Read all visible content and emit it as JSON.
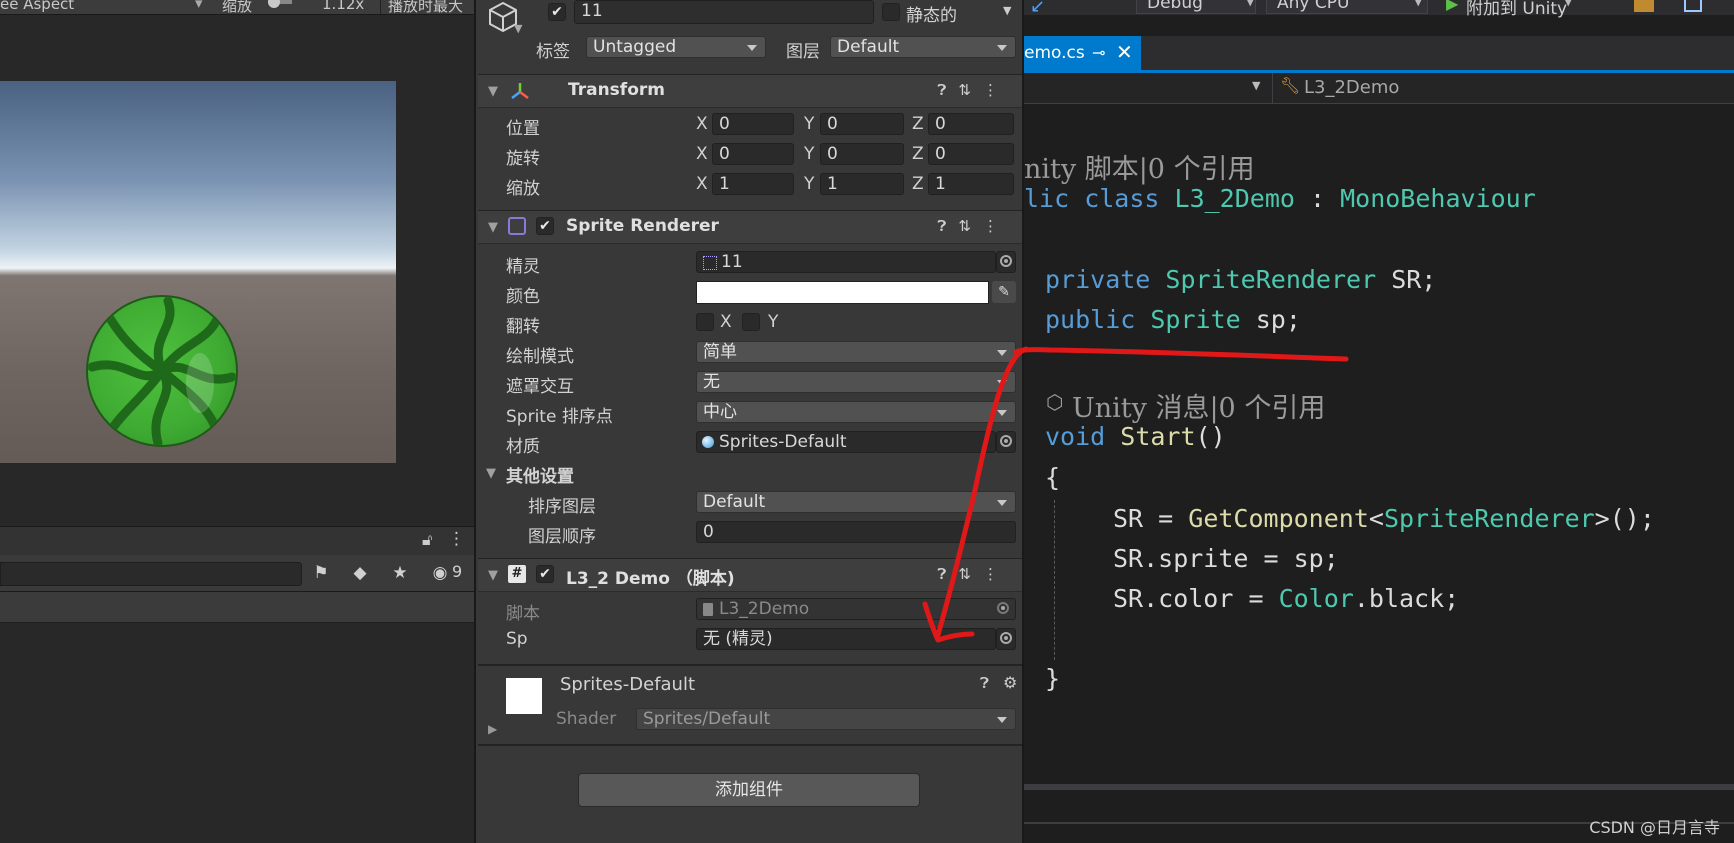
{
  "game_toolbar": {
    "aspect": "ee Aspect",
    "scale_label": "缩放",
    "scale_value": "1.12x",
    "maximize": "播放时最大"
  },
  "hierarchy": {
    "count": "9"
  },
  "inspector": {
    "object_name": "11",
    "static_label": "静态的",
    "tag_label": "标签",
    "tag_value": "Untagged",
    "layer_label": "图层",
    "layer_value": "Default",
    "transform": {
      "title": "Transform",
      "rows": [
        {
          "label": "位置",
          "x": "0",
          "y": "0",
          "z": "0"
        },
        {
          "label": "旋转",
          "x": "0",
          "y": "0",
          "z": "0"
        },
        {
          "label": "缩放",
          "x": "1",
          "y": "1",
          "z": "1"
        }
      ],
      "axis_x": "X",
      "axis_y": "Y",
      "axis_z": "Z"
    },
    "sprite_renderer": {
      "title": "Sprite Renderer",
      "sprite_label": "精灵",
      "sprite_value": "11",
      "color_label": "颜色",
      "color_value": "#ffffff",
      "flip_label": "翻转",
      "flip_x": "X",
      "flip_y": "Y",
      "draw_mode_label": "绘制模式",
      "draw_mode_value": "简单",
      "mask_label": "遮罩交互",
      "mask_value": "无",
      "sort_point_label": "Sprite 排序点",
      "sort_point_value": "中心",
      "material_label": "材质",
      "material_value": "Sprites-Default",
      "additional_label": "其他设置",
      "sorting_layer_label": "排序图层",
      "sorting_layer_value": "Default",
      "order_label": "图层顺序",
      "order_value": "0"
    },
    "script_component": {
      "title": "L3_2 Demo （脚本)",
      "script_label": "脚本",
      "script_value": "L3_2Demo",
      "sp_label": "Sp",
      "sp_value": "无 (精灵)"
    },
    "material_block": {
      "name": "Sprites-Default",
      "shader_label": "Shader",
      "shader_value": "Sprites/Default"
    },
    "add_component": "添加组件"
  },
  "editor": {
    "toolbar": {
      "config": "Debug",
      "platform": "Any CPU",
      "attach": "附加到 Unity"
    },
    "tab_name": "emo.cs",
    "nav_class": "L3_2Demo",
    "lines": {
      "c1": "nity 脚本|0 个引用",
      "l2_kw": "lic class",
      "l2_name": " L3_2Demo",
      "l2_sep": " : ",
      "l2_base": "MonoBehaviour",
      "l3_kw": "private",
      "l3_type": " SpriteRenderer",
      "l3_rest": " SR;",
      "l4_kw": "public",
      "l4_type": " Sprite",
      "l4_rest": " sp;",
      "c2": "Unity 消息|0 个引用",
      "l6_kw": "void",
      "l6_fn": " Start",
      "l6_rest": "()",
      "brace_open": "{",
      "l8_a": "SR = ",
      "l8_fn": "GetComponent",
      "l8_b": "<",
      "l8_type": "SpriteRenderer",
      "l8_c": ">();",
      "l9": "SR.sprite = sp;",
      "l10_a": "SR.color = ",
      "l10_type": "Color",
      "l10_b": ".black;",
      "brace_close": "}"
    }
  },
  "annotation_color": "#e01818",
  "watermark": "CSDN @日月言寺"
}
